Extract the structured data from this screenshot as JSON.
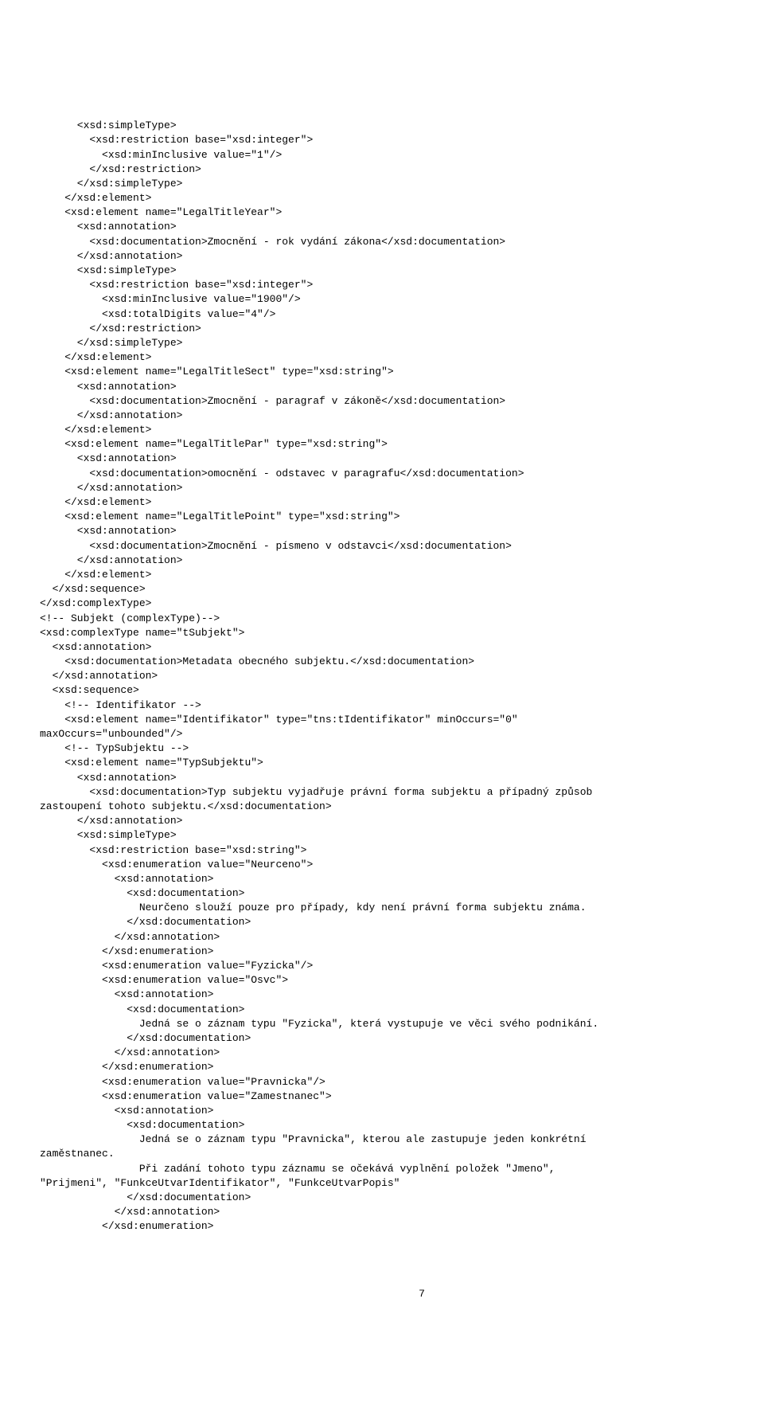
{
  "lines": [
    "      <xsd:simpleType>",
    "        <xsd:restriction base=\"xsd:integer\">",
    "          <xsd:minInclusive value=\"1\"/>",
    "        </xsd:restriction>",
    "      </xsd:simpleType>",
    "    </xsd:element>",
    "    <xsd:element name=\"LegalTitleYear\">",
    "      <xsd:annotation>",
    "        <xsd:documentation>Zmocnění - rok vydání zákona</xsd:documentation>",
    "      </xsd:annotation>",
    "      <xsd:simpleType>",
    "        <xsd:restriction base=\"xsd:integer\">",
    "          <xsd:minInclusive value=\"1900\"/>",
    "          <xsd:totalDigits value=\"4\"/>",
    "        </xsd:restriction>",
    "      </xsd:simpleType>",
    "    </xsd:element>",
    "    <xsd:element name=\"LegalTitleSect\" type=\"xsd:string\">",
    "      <xsd:annotation>",
    "        <xsd:documentation>Zmocnění - paragraf v zákoně</xsd:documentation>",
    "      </xsd:annotation>",
    "    </xsd:element>",
    "    <xsd:element name=\"LegalTitlePar\" type=\"xsd:string\">",
    "      <xsd:annotation>",
    "        <xsd:documentation>omocnění - odstavec v paragrafu</xsd:documentation>",
    "      </xsd:annotation>",
    "    </xsd:element>",
    "    <xsd:element name=\"LegalTitlePoint\" type=\"xsd:string\">",
    "      <xsd:annotation>",
    "        <xsd:documentation>Zmocnění - písmeno v odstavci</xsd:documentation>",
    "      </xsd:annotation>",
    "    </xsd:element>",
    "  </xsd:sequence>",
    "</xsd:complexType>",
    "<!-- Subjekt (complexType)-->",
    "<xsd:complexType name=\"tSubjekt\">",
    "  <xsd:annotation>",
    "    <xsd:documentation>Metadata obecného subjektu.</xsd:documentation>",
    "  </xsd:annotation>",
    "  <xsd:sequence>",
    "    <!-- Identifikator -->",
    "    <xsd:element name=\"Identifikator\" type=\"tns:tIdentifikator\" minOccurs=\"0\"",
    "maxOccurs=\"unbounded\"/>",
    "    <!-- TypSubjektu -->",
    "    <xsd:element name=\"TypSubjektu\">",
    "      <xsd:annotation>",
    "        <xsd:documentation>Typ subjektu vyjadřuje právní forma subjektu a případný způsob",
    "zastoupení tohoto subjektu.</xsd:documentation>",
    "      </xsd:annotation>",
    "      <xsd:simpleType>",
    "        <xsd:restriction base=\"xsd:string\">",
    "          <xsd:enumeration value=\"Neurceno\">",
    "            <xsd:annotation>",
    "              <xsd:documentation>",
    "                Neurčeno slouží pouze pro případy, kdy není právní forma subjektu známa.",
    "              </xsd:documentation>",
    "            </xsd:annotation>",
    "          </xsd:enumeration>",
    "          <xsd:enumeration value=\"Fyzicka\"/>",
    "          <xsd:enumeration value=\"Osvc\">",
    "            <xsd:annotation>",
    "              <xsd:documentation>",
    "                Jedná se o záznam typu \"Fyzicka\", která vystupuje ve věci svého podnikání.",
    "              </xsd:documentation>",
    "            </xsd:annotation>",
    "          </xsd:enumeration>",
    "          <xsd:enumeration value=\"Pravnicka\"/>",
    "          <xsd:enumeration value=\"Zamestnanec\">",
    "            <xsd:annotation>",
    "              <xsd:documentation>",
    "                Jedná se o záznam typu \"Pravnicka\", kterou ale zastupuje jeden konkrétní",
    "zaměstnanec.",
    "                Při zadání tohoto typu záznamu se očekává vyplnění položek \"Jmeno\",",
    "\"Prijmeni\", \"FunkceUtvarIdentifikator\", \"FunkceUtvarPopis\"",
    "              </xsd:documentation>",
    "            </xsd:annotation>",
    "          </xsd:enumeration>"
  ],
  "page_number": "7"
}
